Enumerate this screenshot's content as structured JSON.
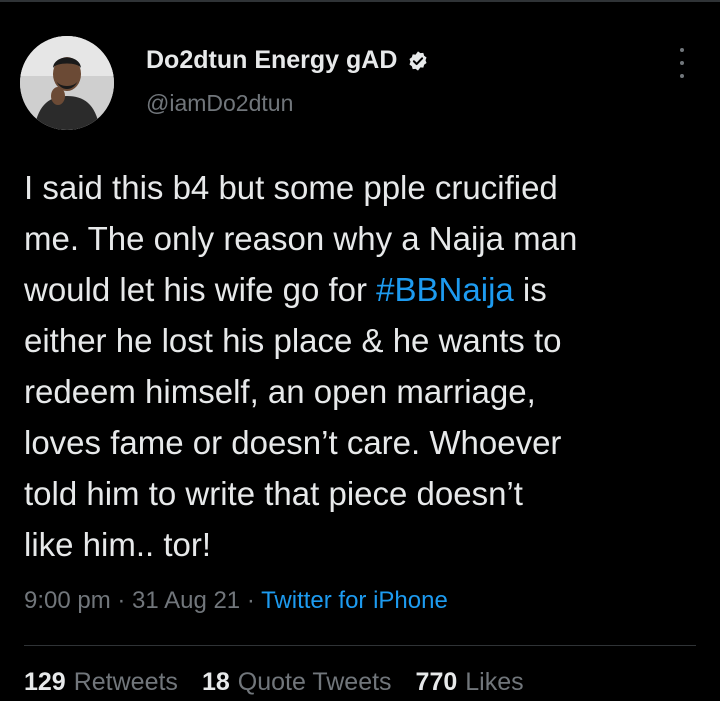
{
  "author": {
    "name": "Do2dtun Energy gAD",
    "handle": "@iamDo2dtun",
    "verified": true
  },
  "tweet": {
    "text_before": "I said this b4 but some pple crucified\nme. The only reason why a Naija man\nwould let his wife go for ",
    "hashtag": "#BBNaija",
    "text_after": " is\neither he lost his place & he wants to\nredeem himself, an open marriage,\nloves fame or doesn’t care. Whoever\ntold him to write that piece doesn’t\nlike him.. tor!"
  },
  "meta": {
    "time": "9:00 pm",
    "sep1": " · ",
    "date": "31 Aug 21",
    "sep2": " · ",
    "source": "Twitter for iPhone"
  },
  "stats": {
    "retweets_count": "129",
    "retweets_label": "Retweets",
    "quotes_count": "18",
    "quotes_label": "Quote Tweets",
    "likes_count": "770",
    "likes_label": "Likes"
  },
  "colors": {
    "background": "#000000",
    "text": "#e7e9ea",
    "muted": "#71767b",
    "link": "#1d9bf0"
  },
  "icons": {
    "more": "more-vertical-icon",
    "verified": "verified-badge-icon"
  }
}
